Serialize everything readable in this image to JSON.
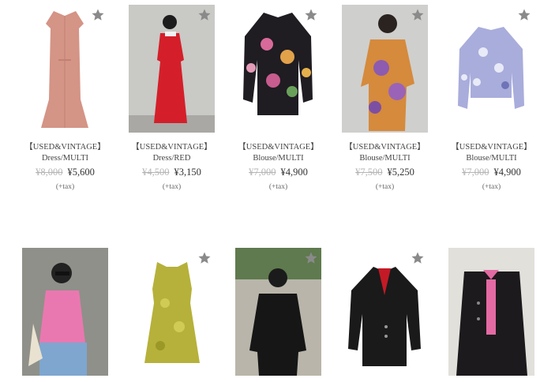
{
  "colors": {
    "accent_star": "#8a8a8a",
    "old_price": "#b5b5b5",
    "text": "#333333"
  },
  "icons": {
    "favorite": "star-icon"
  },
  "products": [
    {
      "title": "【USED&VINTAGE】Dress/MULTI",
      "old_price": "¥8,000",
      "new_price": "¥5,600",
      "tax": "(+tax)"
    },
    {
      "title": "【USED&VINTAGE】Dress/RED",
      "old_price": "¥4,500",
      "new_price": "¥3,150",
      "tax": "(+tax)"
    },
    {
      "title": "【USED&VINTAGE】Blouse/MULTI",
      "old_price": "¥7,000",
      "new_price": "¥4,900",
      "tax": "(+tax)"
    },
    {
      "title": "【USED&VINTAGE】Blouse/MULTI",
      "old_price": "¥7,500",
      "new_price": "¥5,250",
      "tax": "(+tax)"
    },
    {
      "title": "【USED&VINTAGE】Blouse/MULTI",
      "old_price": "¥7,000",
      "new_price": "¥4,900",
      "tax": "(+tax)"
    }
  ]
}
